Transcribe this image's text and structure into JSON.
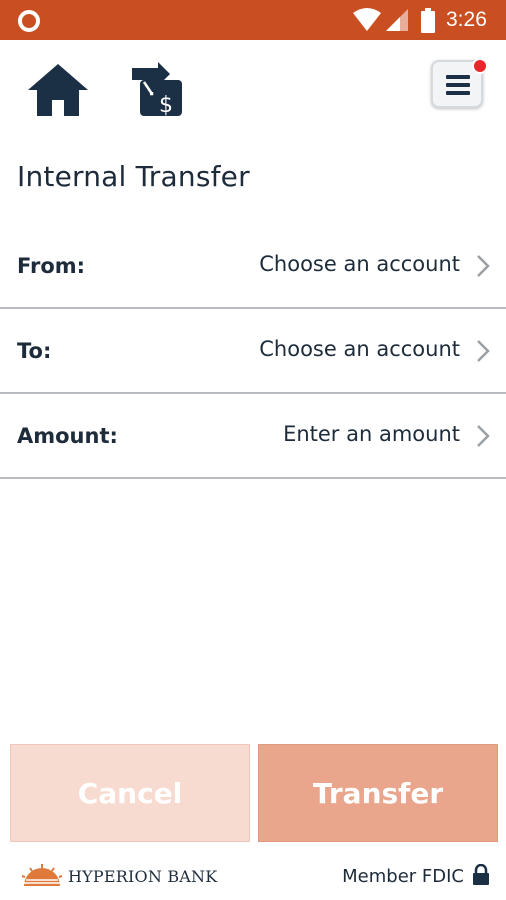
{
  "status_bar": {
    "time": "3:26",
    "background": "#c94f22"
  },
  "header": {
    "home_icon": "home-icon",
    "transfer_icon": "transfer-dollar-icon",
    "menu_icon": "hamburger-menu-icon",
    "notification_color": "#e8262b"
  },
  "page": {
    "title": "Internal Transfer"
  },
  "form": {
    "rows": [
      {
        "label": "From:",
        "value": "Choose an account"
      },
      {
        "label": "To:",
        "value": "Choose an account"
      },
      {
        "label": "Amount:",
        "value": "Enter an amount"
      }
    ]
  },
  "actions": {
    "cancel_label": "Cancel",
    "transfer_label": "Transfer",
    "cancel_color": "#f8dbd0",
    "transfer_color": "#e9a68c"
  },
  "footer": {
    "brand": "HYPERION BANK",
    "member": "Member FDIC"
  }
}
